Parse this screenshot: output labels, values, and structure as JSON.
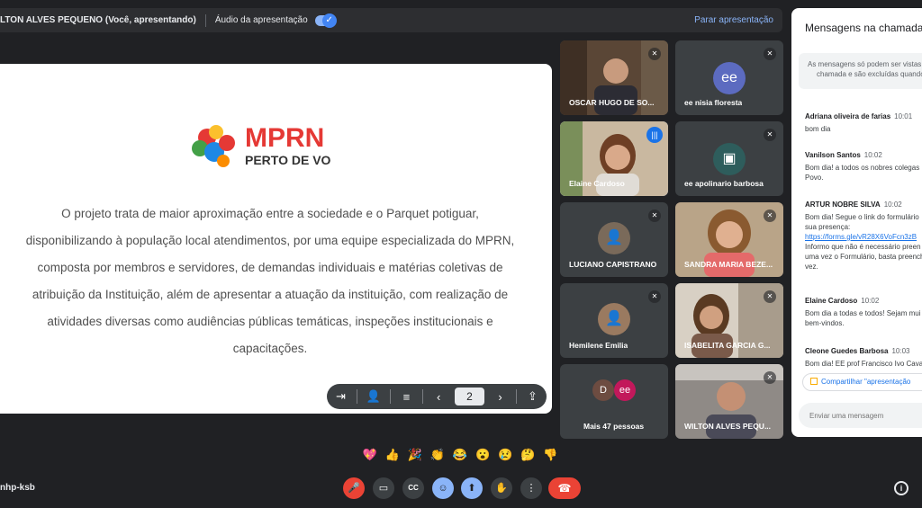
{
  "present_bar": {
    "presenter": "LTON ALVES PEQUENO (Você, apresentando)",
    "audio_label": "Áudio da apresentação",
    "stop_label": "Parar apresentação"
  },
  "slide": {
    "logo_text": "MPRN",
    "logo_subtext": "PERTO DE VOCÊ",
    "lines": [
      "O projeto trata de maior aproximação entre a sociedade e o Parquet potiguar,",
      "disponibilizando à população local atendimentos, por uma equipe especializada do MPRN,",
      "composta por membros e servidores,  de demandas individuais e matérias coletivas de",
      "atribuição da Instituição, além de apresentar a atuação da instituição, com realização de",
      "atividades diversas como audiências públicas temáticas, inspeções institucionais e",
      "capacitações."
    ],
    "page_number": "2"
  },
  "tiles": [
    {
      "name": "OSCAR HUGO DE SO..."
    },
    {
      "name": "ee nisia floresta",
      "initials": "ee"
    },
    {
      "name": "Elaine Cardoso"
    },
    {
      "name": "ee apolinario barbosa"
    },
    {
      "name": "LUCIANO CAPISTRANO"
    },
    {
      "name": "SANDRA MARIA BEZE..."
    },
    {
      "name": "Hemilene Emilia"
    },
    {
      "name": "ISABELITA GARCIA G..."
    },
    {
      "name": "Mais 47 pessoas",
      "initials_a": "D",
      "initials_b": "ee"
    },
    {
      "name": "WILTON ALVES PEQU..."
    }
  ],
  "chat": {
    "title": "Mensagens na chamada",
    "notice_1": "As mensagens só podem ser vistas",
    "notice_2": "chamada e são excluídas quando",
    "messages": [
      {
        "who": "Adriana oliveira de farias",
        "time": "10:01",
        "lines": [
          "bom dia"
        ]
      },
      {
        "who": "Vanilson Santos",
        "time": "10:02",
        "lines": [
          "Bom dia! a todos os nobres colegas",
          "Povo."
        ]
      },
      {
        "who": "ARTUR NOBRE SILVA",
        "time": "10:02",
        "lines": [
          "Bom dia! Segue o link do formulário",
          "sua presença:",
          "https://forms.gle/vR28X6VoFcn3zB",
          "Informo que não é necessário preen",
          "uma vez o Formulário, basta preench",
          "vez."
        ]
      },
      {
        "who": "Elaine Cardoso",
        "time": "10:02",
        "lines": [
          "Bom dia a todas e todos! Sejam mui",
          "bem-vindos."
        ]
      },
      {
        "who": "Cleone Guedes Barbosa",
        "time": "10:03",
        "lines": [
          "Bom dia! EE prof Francisco Ivo Cava"
        ]
      }
    ],
    "share_chip": "Compartilhar \"apresentação",
    "input_placeholder": "Enviar uma mensagem"
  },
  "reactions": [
    "💖",
    "👍",
    "🎉",
    "👏",
    "😂",
    "😮",
    "😢",
    "🤔",
    "👎"
  ],
  "meeting_code": "nhp-ksb",
  "controls": {
    "mic": "🎤",
    "camera": "▭",
    "captions": "CC",
    "emoji": "☺",
    "present": "⬆",
    "hand": "✋",
    "more": "⋮",
    "end": "☎",
    "info": "i"
  }
}
